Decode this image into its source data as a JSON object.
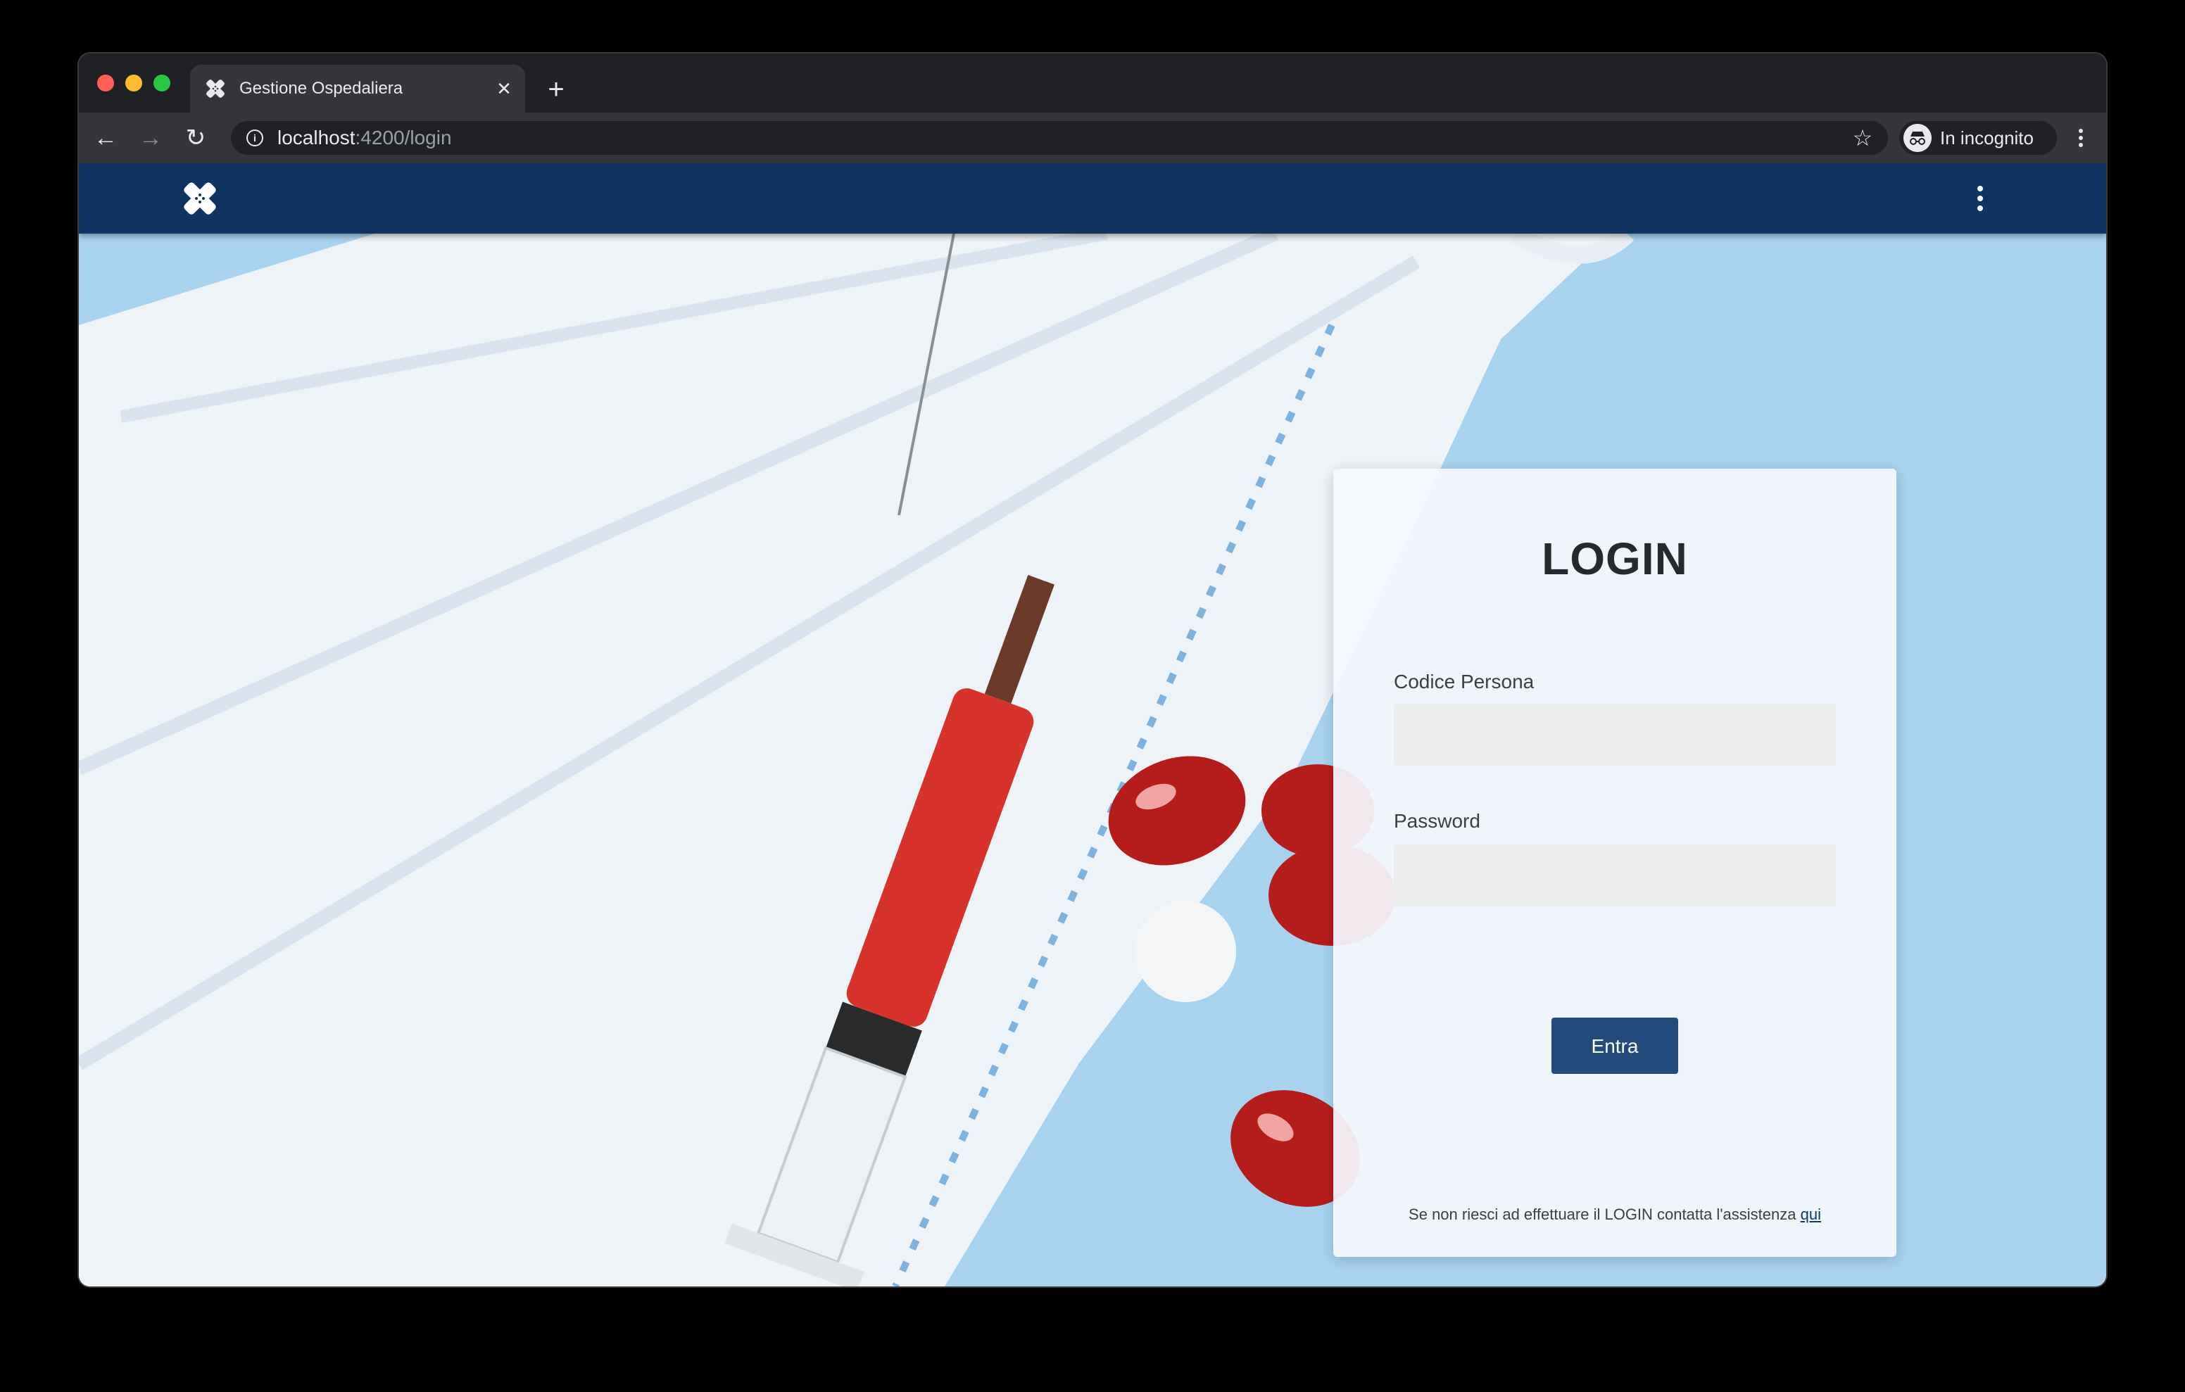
{
  "browser": {
    "tab_title": "Gestione Ospedaliera",
    "url_host": "localhost",
    "url_path": ":4200/login",
    "incognito_label": "In incognito"
  },
  "login": {
    "title": "LOGIN",
    "codice_label": "Codice Persona",
    "codice_value": "",
    "password_label": "Password",
    "password_value": "",
    "submit_label": "Entra",
    "help_text": "Se non riesci ad effettuare il LOGIN contatta l'assistenza",
    "help_link": "qui"
  },
  "colors": {
    "appbar": "#11335f",
    "button": "#234a7a",
    "background": "#a9d2ef"
  }
}
